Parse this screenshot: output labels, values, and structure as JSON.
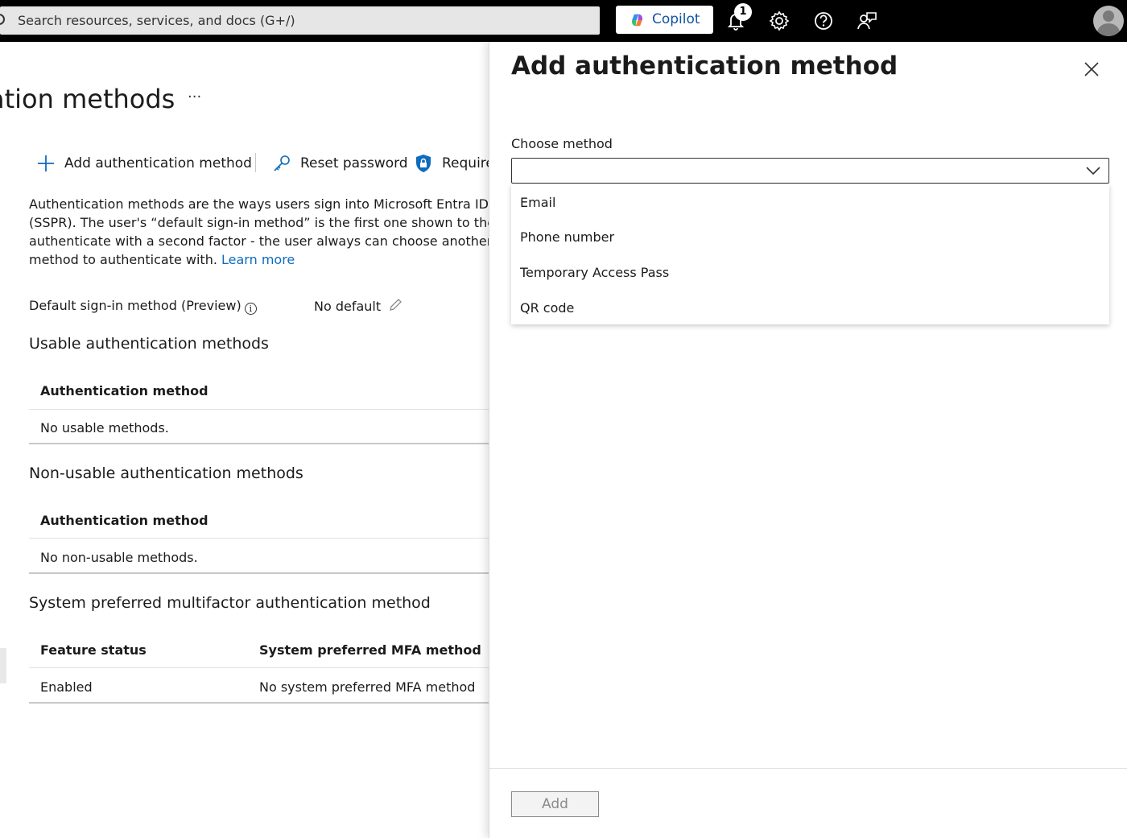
{
  "topbar": {
    "search_placeholder": "Search resources, services, and docs (G+/)",
    "copilot_label": "Copilot",
    "notification_count": "1",
    "icons": [
      "search-icon",
      "bell-icon",
      "gear-icon",
      "help-icon",
      "feedback-icon",
      "avatar"
    ]
  },
  "page": {
    "title_fragment": "ation methods",
    "more_label": "···",
    "toolbar": {
      "add_label": "Add authentication method",
      "reset_label": "Reset password",
      "require_label": "Require"
    },
    "description_lines": [
      "Authentication methods are the ways users sign into Microsoft Entra ID ar",
      "(SSPR). The user's “default sign-in method” is the first one shown to the u",
      "authenticate with a second factor - the user always can choose another re",
      "method to authenticate with."
    ],
    "learn_more": "Learn more",
    "default_signin": {
      "label": "Default sign-in method (Preview)",
      "value": "No default"
    },
    "usable": {
      "heading": "Usable authentication methods",
      "column": "Authentication method",
      "empty": "No usable methods."
    },
    "non_usable": {
      "heading": "Non-usable authentication methods",
      "column": "Authentication method",
      "empty": "No non-usable methods."
    },
    "system_preferred": {
      "heading": "System preferred multifactor authentication method",
      "col_status": "Feature status",
      "col_method": "System preferred MFA method",
      "status_value": "Enabled",
      "method_value": "No system preferred MFA method"
    }
  },
  "panel": {
    "title": "Add authentication method",
    "choose_label": "Choose method",
    "selected_value": "",
    "options": [
      "Email",
      "Phone number",
      "Temporary Access Pass",
      "QR code"
    ],
    "add_button": "Add"
  },
  "colors": {
    "topbar_bg": "#000000",
    "link": "#0f6cbd",
    "copilot_text": "#0f54a6",
    "disabled_text": "#8a8a8a"
  }
}
